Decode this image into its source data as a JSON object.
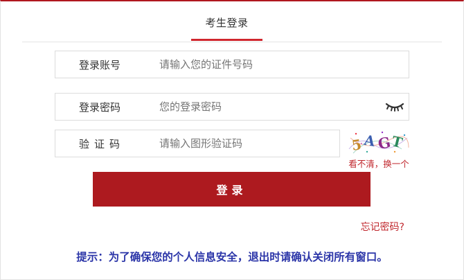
{
  "tab": {
    "title": "考生登录"
  },
  "account": {
    "label": "登录账号",
    "placeholder": "请输入您的证件号码",
    "value": ""
  },
  "password": {
    "label": "登录密码",
    "placeholder": "您的登录密码",
    "value": "",
    "toggle_icon": "eye-closed-icon"
  },
  "captcha": {
    "label": "验证码",
    "placeholder": "请输入图形验证码",
    "value": "",
    "image_text": "5AGT",
    "refresh_label": "看不清，换一个"
  },
  "login_button": {
    "label": "登录"
  },
  "forgot_link": {
    "label": "忘记密码?"
  },
  "tip": {
    "text": "提示：为了确保您的个人信息安全，退出时请确认关闭所有窗口。"
  },
  "colors": {
    "accent": "#ad1a1f",
    "link": "#c0272d",
    "tip": "#2b35a8"
  }
}
